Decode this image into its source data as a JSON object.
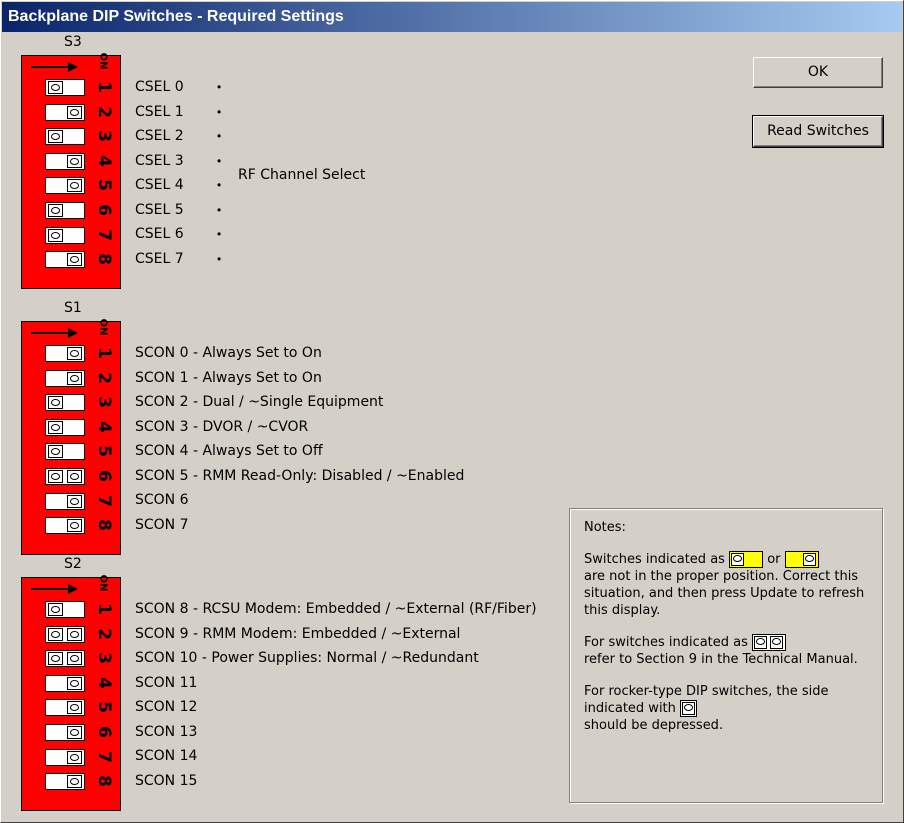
{
  "window": {
    "title": "Backplane DIP Switches - Required Settings"
  },
  "buttons": {
    "ok": "OK",
    "read": "Read Switches"
  },
  "on_label": "ON",
  "groups": [
    {
      "name": "S3",
      "bracket_label": "RF Channel Select",
      "rows": [
        {
          "num": "1",
          "label": "CSEL 0",
          "dot": "•",
          "pos": "left"
        },
        {
          "num": "2",
          "label": "CSEL 1",
          "dot": "•",
          "pos": "right"
        },
        {
          "num": "3",
          "label": "CSEL 2",
          "dot": "•",
          "pos": "left"
        },
        {
          "num": "4",
          "label": "CSEL 3",
          "dot": "•",
          "pos": "right"
        },
        {
          "num": "5",
          "label": "CSEL 4",
          "dot": "•",
          "pos": "right"
        },
        {
          "num": "6",
          "label": "CSEL 5",
          "dot": "•",
          "pos": "left"
        },
        {
          "num": "7",
          "label": "CSEL 6",
          "dot": "•",
          "pos": "left"
        },
        {
          "num": "8",
          "label": "CSEL 7",
          "dot": "•",
          "pos": "right"
        }
      ]
    },
    {
      "name": "S1",
      "rows": [
        {
          "num": "1",
          "label": "SCON 0 - Always Set to On",
          "pos": "right"
        },
        {
          "num": "2",
          "label": "SCON 1 - Always Set to On",
          "pos": "right"
        },
        {
          "num": "3",
          "label": "SCON 2 - Dual / ~Single Equipment",
          "pos": "left"
        },
        {
          "num": "4",
          "label": "SCON 3 - DVOR / ~CVOR",
          "pos": "left"
        },
        {
          "num": "5",
          "label": "SCON 4 - Always Set to Off",
          "pos": "left"
        },
        {
          "num": "6",
          "label": "SCON 5 - RMM Read-Only: Disabled / ~Enabled",
          "pos": "both"
        },
        {
          "num": "7",
          "label": "SCON 6",
          "pos": "right"
        },
        {
          "num": "8",
          "label": "SCON 7",
          "pos": "right"
        }
      ]
    },
    {
      "name": "S2",
      "rows": [
        {
          "num": "1",
          "label": "SCON 8 - RCSU Modem: Embedded / ~External (RF/Fiber)",
          "pos": "left"
        },
        {
          "num": "2",
          "label": "SCON 9 - RMM Modem: Embedded / ~External",
          "pos": "both"
        },
        {
          "num": "3",
          "label": "SCON 10 - Power Supplies: Normal / ~Redundant",
          "pos": "both"
        },
        {
          "num": "4",
          "label": "SCON 11",
          "pos": "right"
        },
        {
          "num": "5",
          "label": "SCON 12",
          "pos": "right"
        },
        {
          "num": "6",
          "label": "SCON 13",
          "pos": "right"
        },
        {
          "num": "7",
          "label": "SCON 14",
          "pos": "right"
        },
        {
          "num": "8",
          "label": "SCON 15",
          "pos": "right"
        }
      ]
    }
  ],
  "notes": {
    "heading": "Notes:",
    "p1a": "Switches indicated as",
    "p1or": "or",
    "p1b": "are not in the proper position. Correct this situation, and then press Update to refresh this display.",
    "p2a": "For switches indicated as",
    "p2b": "refer to Section 9 in the Technical Manual.",
    "p3a": "For rocker-type DIP switches, the side indicated with",
    "p3b": "should be depressed."
  },
  "colors": {
    "dip": "#ff0000",
    "warning": "#ffff00",
    "titlebar": "#0a246a"
  }
}
